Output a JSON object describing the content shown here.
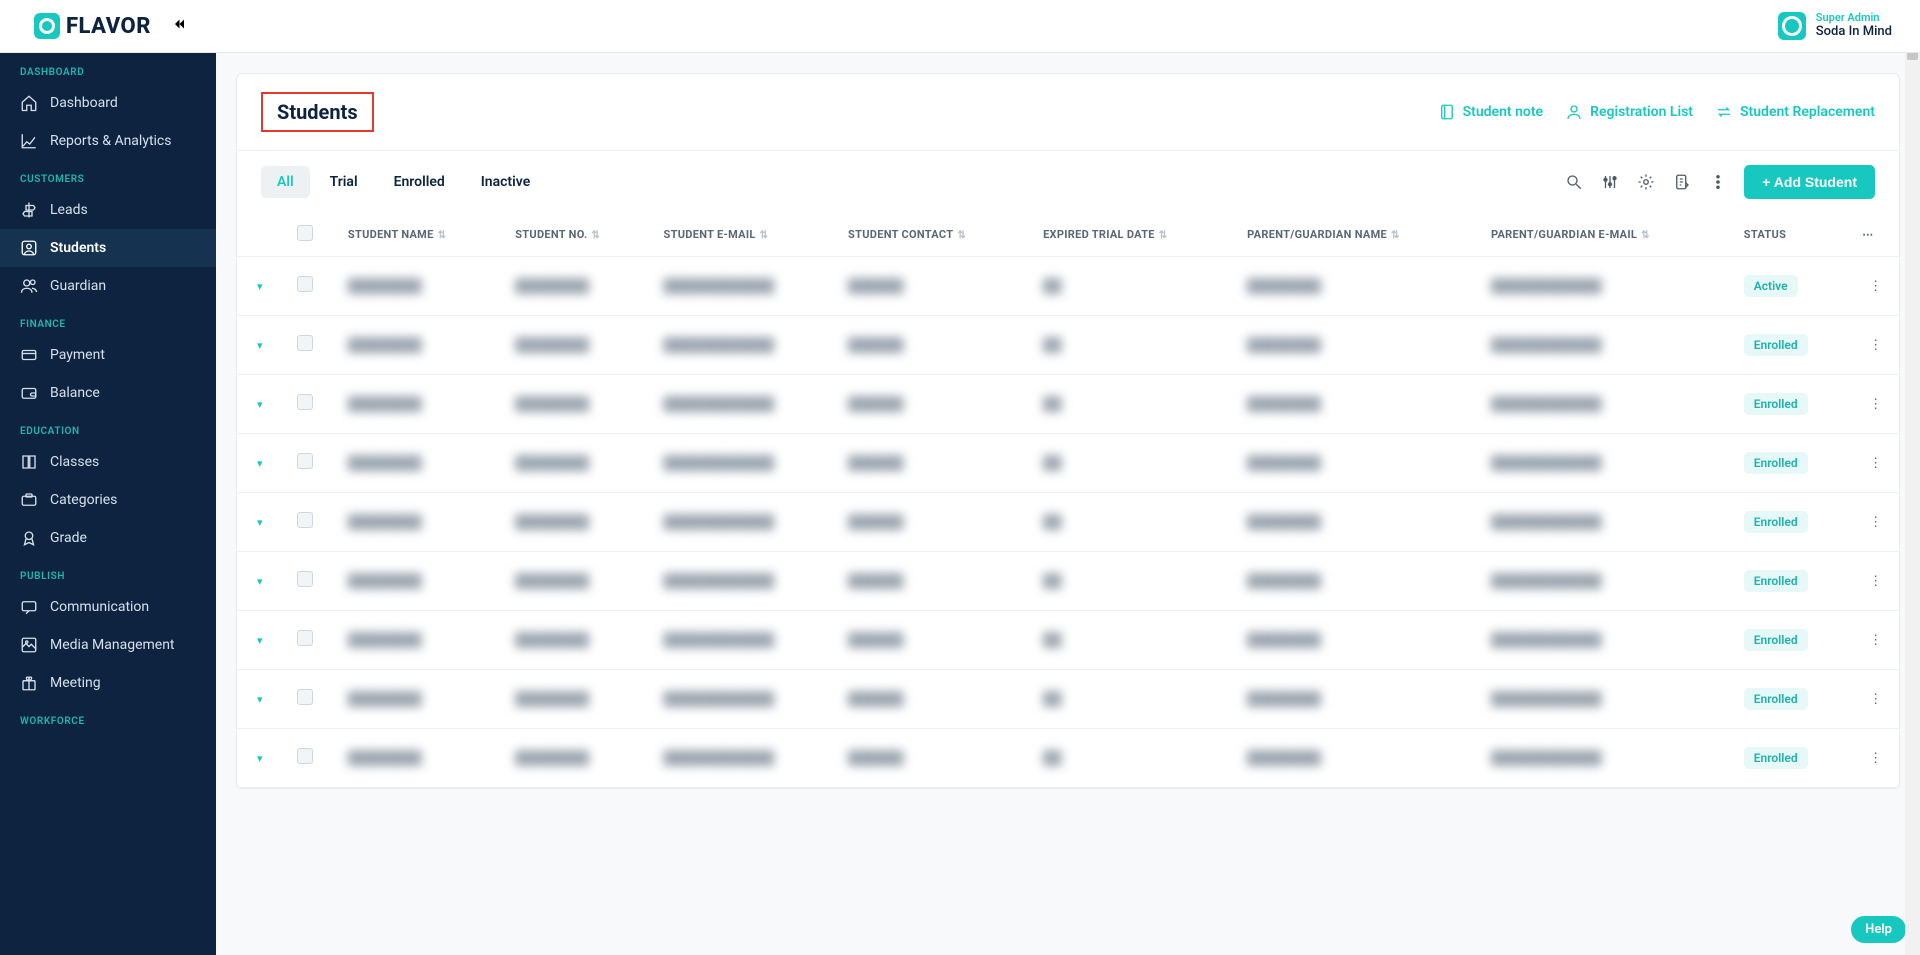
{
  "brand": {
    "name": "FLAVOR"
  },
  "profile": {
    "role": "Super Admin",
    "org": "Soda In Mind"
  },
  "sidebar": {
    "sections": [
      {
        "label": "DASHBOARD",
        "items": [
          {
            "label": "Dashboard",
            "icon": "home"
          },
          {
            "label": "Reports & Analytics",
            "icon": "chart"
          }
        ]
      },
      {
        "label": "CUSTOMERS",
        "items": [
          {
            "label": "Leads",
            "icon": "signpost"
          },
          {
            "label": "Students",
            "icon": "user-square",
            "active": true
          },
          {
            "label": "Guardian",
            "icon": "users"
          }
        ]
      },
      {
        "label": "FINANCE",
        "items": [
          {
            "label": "Payment",
            "icon": "card"
          },
          {
            "label": "Balance",
            "icon": "wallet"
          }
        ]
      },
      {
        "label": "EDUCATION",
        "items": [
          {
            "label": "Classes",
            "icon": "book"
          },
          {
            "label": "Categories",
            "icon": "tag"
          },
          {
            "label": "Grade",
            "icon": "badge"
          }
        ]
      },
      {
        "label": "PUBLISH",
        "items": [
          {
            "label": "Communication",
            "icon": "chat"
          },
          {
            "label": "Media Management",
            "icon": "media"
          },
          {
            "label": "Meeting",
            "icon": "gift"
          }
        ]
      },
      {
        "label": "WORKFORCE",
        "items": []
      }
    ]
  },
  "page": {
    "title": "Students",
    "actions": {
      "note": "Student note",
      "registration": "Registration List",
      "replacement": "Student Replacement"
    },
    "tabs": {
      "all": "All",
      "trial": "Trial",
      "enrolled": "Enrolled",
      "inactive": "Inactive"
    },
    "addButton": "+ Add Student",
    "columns": {
      "student_name": "STUDENT NAME",
      "student_no": "STUDENT NO.",
      "student_email": "STUDENT E-MAIL",
      "student_contact": "STUDENT CONTACT",
      "expired_trial": "EXPIRED TRIAL DATE",
      "guardian_name": "PARENT/GUARDIAN NAME",
      "guardian_email": "PARENT/GUARDIAN E-MAIL",
      "status": "STATUS"
    },
    "rows": [
      {
        "status": "Active"
      },
      {
        "status": "Enrolled"
      },
      {
        "status": "Enrolled"
      },
      {
        "status": "Enrolled"
      },
      {
        "status": "Enrolled"
      },
      {
        "status": "Enrolled"
      },
      {
        "status": "Enrolled"
      },
      {
        "status": "Enrolled"
      },
      {
        "status": "Enrolled"
      }
    ]
  },
  "help": {
    "label": "Help"
  }
}
